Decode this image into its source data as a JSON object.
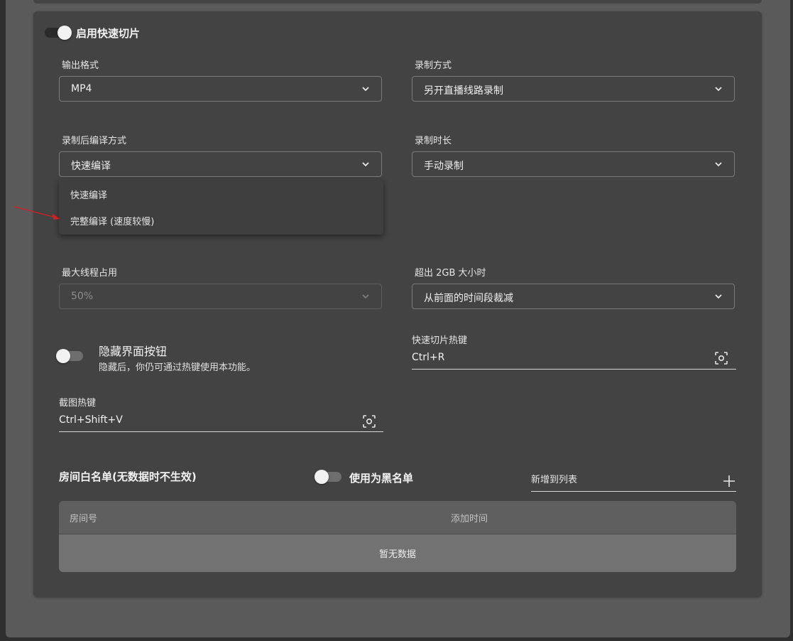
{
  "quick_clip": {
    "toggle_label": "启用快速切片",
    "enabled": true
  },
  "output_format": {
    "label": "输出格式",
    "value": "MP4"
  },
  "record_mode": {
    "label": "录制方式",
    "value": "另开直播线路录制"
  },
  "compile_mode": {
    "label": "录制后编译方式",
    "value": "快速编译",
    "options": [
      "快速编译",
      "完整编译 (速度较慢)"
    ]
  },
  "record_duration": {
    "label": "录制时长",
    "value": "手动录制"
  },
  "max_threads": {
    "label": "最大线程占用",
    "value": "50%"
  },
  "over_2gb": {
    "label": "超出 2GB 大小时",
    "value": "从前面的时间段裁减"
  },
  "hide_button": {
    "title": "隐藏界面按钮",
    "description": "隐藏后，你仍可通过热键使用本功能。",
    "enabled": false
  },
  "clip_hotkey": {
    "label": "快速切片热键",
    "value": "Ctrl+R"
  },
  "screenshot_hotkey": {
    "label": "截图热键",
    "value": "Ctrl+Shift+V"
  },
  "whitelist": {
    "title": "房间白名单(无数据时不生效)",
    "blacklist_toggle_label": "使用为黑名单",
    "blacklist_enabled": false,
    "add_placeholder": "新增到列表",
    "columns": [
      "房间号",
      "添加时间"
    ],
    "empty_text": "暂无数据"
  },
  "colors": {
    "annotation_arrow": "#d62020"
  }
}
